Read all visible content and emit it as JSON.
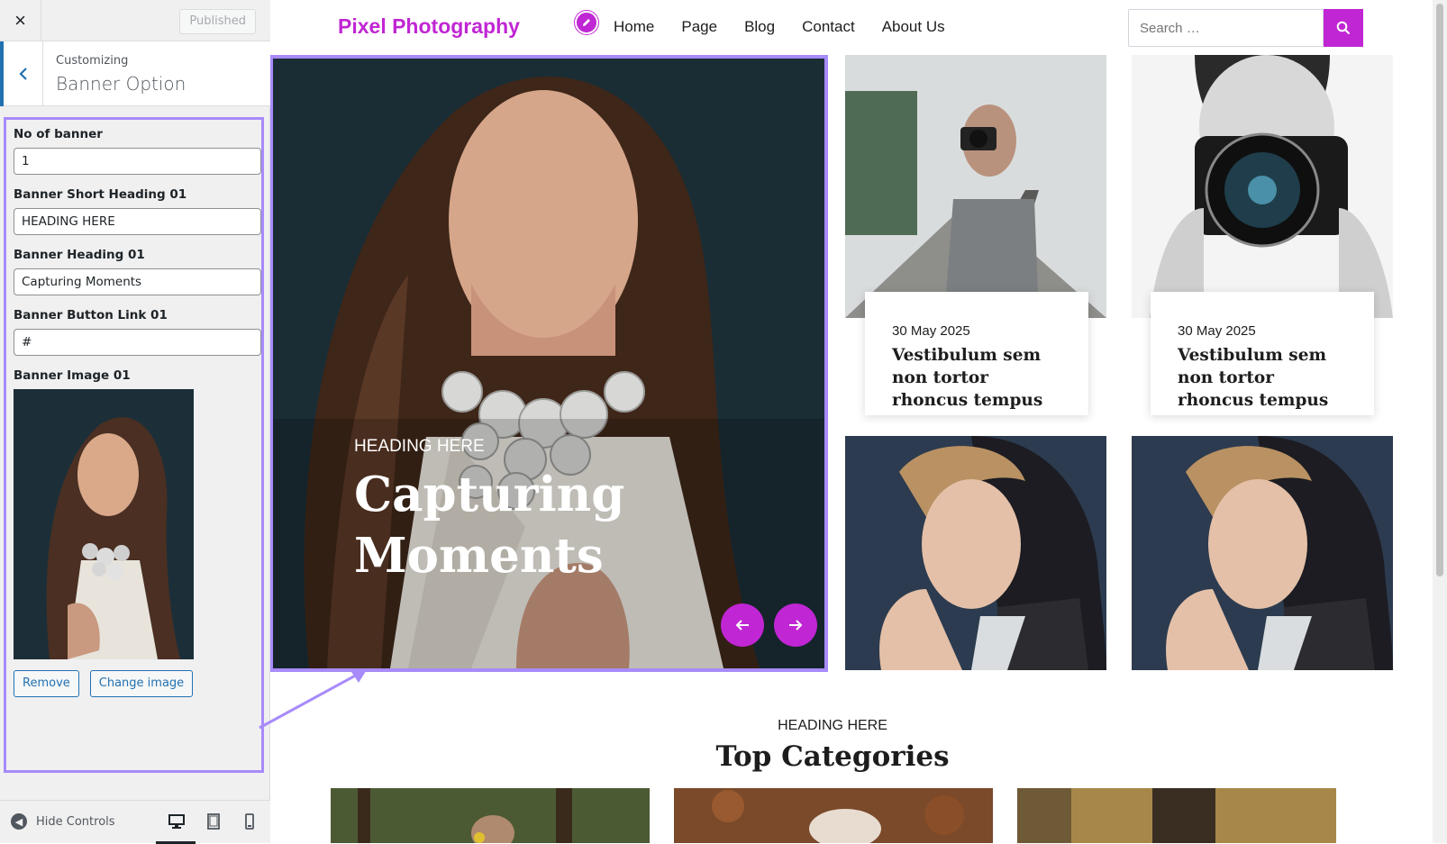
{
  "customizer": {
    "close_label": "×",
    "published_label": "Published",
    "customizing_label": "Customizing",
    "section_title": "Banner Option",
    "fields": [
      {
        "label": "No of banner",
        "value": "1"
      },
      {
        "label": "Banner Short Heading 01",
        "value": "HEADING HERE"
      },
      {
        "label": "Banner Heading 01",
        "value": "Capturing Moments"
      },
      {
        "label": "Banner Button Link 01",
        "value": "#"
      }
    ],
    "image_label": "Banner Image 01",
    "remove_label": "Remove",
    "change_label": "Change image",
    "hide_controls_label": "Hide Controls",
    "accent_color": "#2271b1",
    "highlight_color": "#a78bfa"
  },
  "site": {
    "title": "Pixel Photography",
    "nav": [
      "Home",
      "Page",
      "Blog",
      "Contact",
      "About Us"
    ],
    "search_placeholder": "Search …",
    "brand_color": "#c026d3",
    "banner": {
      "short_heading": "HEADING HERE",
      "heading": "Capturing Moments"
    },
    "posts": [
      {
        "date": "30 May 2025",
        "title": "Vestibulum sem non tortor rhoncus tempus"
      },
      {
        "date": "30 May 2025",
        "title": "Vestibulum sem non tortor rhoncus tempus"
      }
    ],
    "section": {
      "small_heading": "HEADING HERE",
      "big_heading": "Top Categories"
    }
  }
}
